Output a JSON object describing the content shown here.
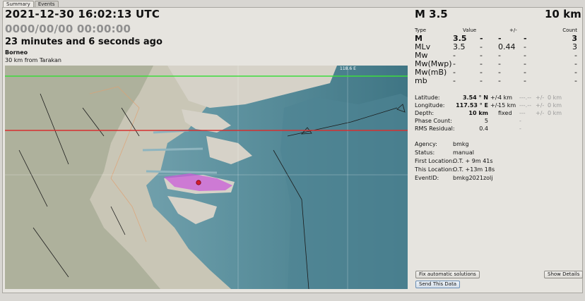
{
  "tabs": [
    {
      "label": "Summary",
      "active": true
    },
    {
      "label": "Events",
      "active": false
    }
  ],
  "origin_time": "2021-12-30 16:02:13 UTC",
  "local_time": "0000/00/00  00:00:00",
  "time_ago": "23 minutes and 6 seconds ago",
  "region": "Borneo",
  "nearest_city": "30 km from Tarakan",
  "map": {
    "grid_label": "118.6 E",
    "colors": {
      "sea_deep": "#4f8493",
      "sea_shallow": "#8fb5bf",
      "land": "#d6d2c8",
      "terrain": "#b4b7a2",
      "green_line": "#3ddc3d",
      "red_line": "#d63030",
      "epicenter": "#d21e2e",
      "uncertainty": "#c95cd8"
    }
  },
  "headline": {
    "magnitude": "M 3.5",
    "depth": "10 km"
  },
  "magnitudes": {
    "headers": {
      "type": "Type",
      "value": "Value",
      "uncertainty": "+/-",
      "count": "Count"
    },
    "rows": [
      {
        "type": "M",
        "value": "3.5",
        "d1": "-",
        "unc": "-",
        "d2": "-",
        "count": "3",
        "big": true,
        "bold": true
      },
      {
        "type": "MLv",
        "value": "3.5",
        "d1": "-",
        "unc": "0.44",
        "d2": "-",
        "count": "3",
        "big": true,
        "bold": false
      },
      {
        "type": "Mw",
        "value": "-",
        "d1": "-",
        "unc": "-",
        "d2": "-",
        "count": "-",
        "big": true,
        "bold": false
      },
      {
        "type": "Mw(Mwp)",
        "value": "-",
        "d1": "-",
        "unc": "-",
        "d2": "-",
        "count": "-",
        "big": true,
        "bold": false
      },
      {
        "type": "Mw(mB)",
        "value": "-",
        "d1": "-",
        "unc": "-",
        "d2": "-",
        "count": "-",
        "big": true,
        "bold": false
      },
      {
        "type": "mb",
        "value": "-",
        "d1": "-",
        "unc": "-",
        "d2": "-",
        "count": "-",
        "big": true,
        "bold": false
      }
    ]
  },
  "location": {
    "rows": [
      {
        "label": "Latitude:",
        "value": "3.54 ° N",
        "pm": "+/-",
        "unc": "4 km",
        "extra": "---.--",
        "pm2": "+/-",
        "unc2": "0 km"
      },
      {
        "label": "Longitude:",
        "value": "117.53 ° E",
        "pm": "+/-",
        "unc": "15 km",
        "extra": "---.--",
        "pm2": "+/-",
        "unc2": "0 km"
      },
      {
        "label": "Depth:",
        "value": "10 km",
        "pm": "",
        "unc": "fixed",
        "extra": "---",
        "pm2": "+/-",
        "unc2": "0 km"
      },
      {
        "label": "Phase Count:",
        "value": "5",
        "pm": "",
        "unc": "",
        "extra": "-",
        "pm2": "",
        "unc2": ""
      },
      {
        "label": "RMS Residual:",
        "value": "0.4",
        "pm": "",
        "unc": "",
        "extra": "-",
        "pm2": "",
        "unc2": ""
      }
    ]
  },
  "event_info": [
    {
      "label": "Agency:",
      "value": "bmkg"
    },
    {
      "label": "Status:",
      "value": "manual"
    },
    {
      "label": "First Location:",
      "value": "O.T. + 9m 41s"
    },
    {
      "label": "This Location:",
      "value": "O.T. +13m 18s"
    },
    {
      "label": "EventID:",
      "value": "bmkg2021zolj"
    }
  ],
  "buttons": {
    "fix": "Fix automatic solutions",
    "details": "Show Details",
    "send": "Send This Data"
  }
}
